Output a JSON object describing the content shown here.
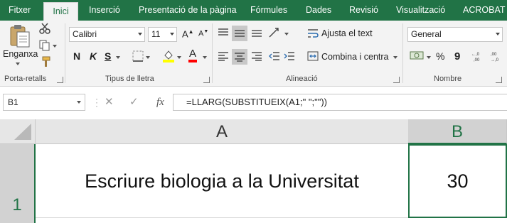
{
  "tabs": [
    {
      "label": "Fitxer",
      "active": false
    },
    {
      "label": "Inici",
      "active": true
    },
    {
      "label": "Inserció",
      "active": false
    },
    {
      "label": "Presentació de la pàgina",
      "active": false
    },
    {
      "label": "Fórmules",
      "active": false
    },
    {
      "label": "Dades",
      "active": false
    },
    {
      "label": "Revisió",
      "active": false
    },
    {
      "label": "Visualització",
      "active": false
    },
    {
      "label": "ACROBAT",
      "active": false
    }
  ],
  "clipboard": {
    "paste_label": "Enganxa",
    "group_label": "Porta-retalls"
  },
  "font": {
    "name": "Calibri",
    "size": "11",
    "bold": "N",
    "italic": "K",
    "underline": "S",
    "group_label": "Tipus de lletra",
    "fill_color": "#ffff00",
    "font_color": "#ff0000"
  },
  "alignment": {
    "wrap_label": "Ajusta el text",
    "merge_label": "Combina i centra",
    "group_label": "Alineació"
  },
  "number": {
    "format": "General",
    "group_label": "Nombre",
    "percent": "%",
    "comma": "9"
  },
  "formula_bar": {
    "name_box": "B1",
    "fx": "fx",
    "formula": "=LLARG(SUBSTITUEIX(A1;\" \";\"\"))"
  },
  "sheet": {
    "columns": [
      "A",
      "B"
    ],
    "rows": [
      "1"
    ],
    "cells": {
      "A1": "Escriure biologia a la Universitat",
      "B1": "30"
    },
    "selected": "B1"
  },
  "accent_color": "#217346"
}
